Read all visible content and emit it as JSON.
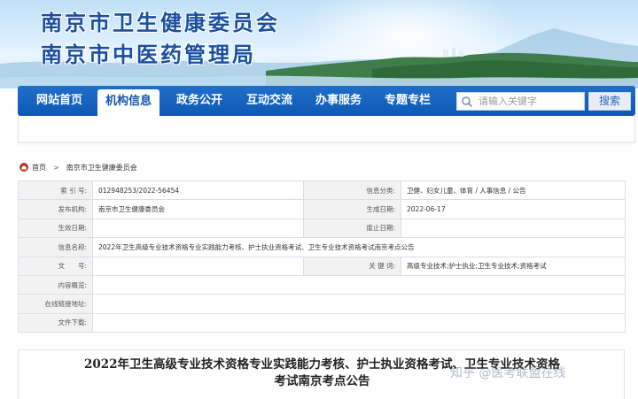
{
  "header": {
    "title_line1": "南京市卫生健康委员会",
    "title_line2": "南京市中医药管理局"
  },
  "nav": {
    "items": [
      {
        "label": "网站首页"
      },
      {
        "label": "机构信息",
        "active": true
      },
      {
        "label": "政务公开"
      },
      {
        "label": "互动交流"
      },
      {
        "label": "办事服务"
      },
      {
        "label": "专题专栏"
      }
    ],
    "search_placeholder": "请输入关键字",
    "search_button": "搜索"
  },
  "breadcrumb": {
    "home": "首页",
    "separator": ">",
    "current": "南京市卫生健康委员会"
  },
  "info": {
    "index_label": "索 引 号:",
    "index_value": "012948253/2022-56454",
    "category_label": "信息分类:",
    "category_value": "卫健、妇女儿童、体育 / 人事信息 / 公告",
    "publisher_label": "发布机构:",
    "publisher_value": "南京市卫生健康委员会",
    "date_label": "生成日期:",
    "date_value": "2022-06-17",
    "effective_label": "生效日期:",
    "effective_value": "",
    "abolish_label": "废止日期:",
    "abolish_value": "",
    "name_label": "信息名称:",
    "name_value": "2022年卫生高级专业技术资格专业实践能力考核、护士执业资格考试、卫生专业技术资格考试南京考点公告",
    "docno_label": "文　　号:",
    "docno_value": "",
    "keywords_label": "关 键 词:",
    "keywords_value": "高级专业技术;护士执业;卫生专业技术;资格考试",
    "summary_label": "内容概览:",
    "summary_value": "",
    "link_label": "在线链接地址:",
    "link_value": "",
    "download_label": "文件下载:",
    "download_value": ""
  },
  "article": {
    "title_line1": "2022年卫生高级专业技术资格专业实践能力考核、护士执业资格考试、卫生专业技术资格",
    "title_line2": "考试南京考点公告"
  },
  "watermark": "知乎 @医考联盟在线",
  "colors": {
    "nav_blue": "#1257b0",
    "title_blue": "#1a4fa0",
    "label_bg": "#f2f2f2"
  }
}
